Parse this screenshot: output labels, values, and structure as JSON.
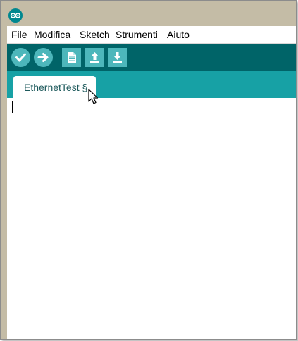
{
  "app": {
    "icon_name": "arduino-logo-icon"
  },
  "menu": {
    "items": [
      {
        "label": "File"
      },
      {
        "label": "Modifica"
      },
      {
        "label": "Sketch"
      },
      {
        "label": "Strumenti"
      },
      {
        "label": "Aiuto"
      }
    ]
  },
  "toolbar": {
    "buttons": [
      {
        "icon": "verify-check-icon"
      },
      {
        "icon": "upload-arrow-icon"
      },
      {
        "icon": "new-file-icon"
      },
      {
        "icon": "open-arrow-up-icon"
      },
      {
        "icon": "save-arrow-down-icon"
      }
    ]
  },
  "tabs": [
    {
      "label": "EthernetTest §",
      "active": true
    }
  ],
  "editor": {
    "content": ""
  },
  "colors": {
    "titlebar": "#c4bca6",
    "toolbar": "#006468",
    "toolbar_button": "#4db7bb",
    "tabbar": "#17a1a5",
    "tab_text": "#1e5a5c"
  }
}
